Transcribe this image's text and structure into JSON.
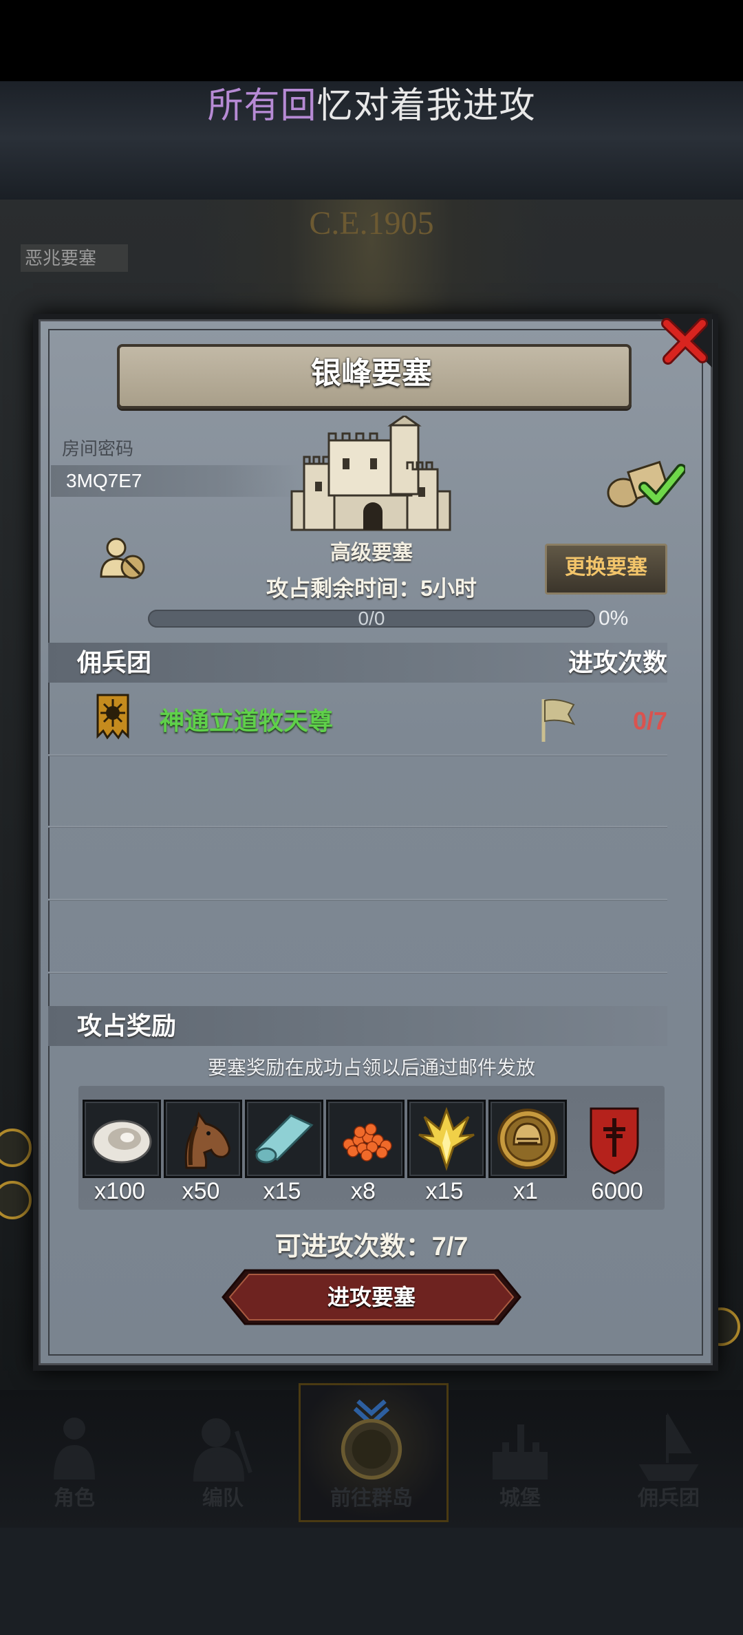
{
  "caption": {
    "highlight": "所有回",
    "rest": "忆对着我进攻"
  },
  "background": {
    "year": "C.E.1905",
    "fortress_tag": "恶兆要塞"
  },
  "dialog": {
    "title": "银峰要塞",
    "room_code_label": "房间密码",
    "room_code": "3MQ7E7",
    "fortress_level": "高级要塞",
    "time_remaining": "攻占剩余时间：5小时",
    "progress_text": "0/0",
    "progress_percent": "0%",
    "progress_fraction": 0,
    "change_button": "更换要塞",
    "mercenary_header": "佣兵团",
    "attacks_header": "进攻次数",
    "mercenaries": [
      {
        "name": "神通立道牧天尊",
        "attacks": "0/7"
      }
    ],
    "reward_header": "攻占奖励",
    "reward_note": "要塞奖励在成功占领以后通过邮件发放",
    "rewards": [
      {
        "icon": "oyster-icon",
        "qty": "x100"
      },
      {
        "icon": "horse-icon",
        "qty": "x50"
      },
      {
        "icon": "cloth-roll-icon",
        "qty": "x15"
      },
      {
        "icon": "caviar-icon",
        "qty": "x8"
      },
      {
        "icon": "golden-crest-icon",
        "qty": "x15"
      },
      {
        "icon": "knight-helmet-icon",
        "qty": "x1"
      },
      {
        "icon": "red-shield-icon",
        "qty": "6000"
      }
    ],
    "attack_count": "可进攻次数：7/7",
    "attack_button": "进攻要塞"
  },
  "nav": [
    {
      "label": "角色",
      "icon": "character-icon"
    },
    {
      "label": "编队",
      "icon": "formation-icon"
    },
    {
      "label": "前往群岛",
      "icon": "islands-icon"
    },
    {
      "label": "城堡",
      "icon": "castle-icon"
    },
    {
      "label": "佣兵团",
      "icon": "ship-icon"
    }
  ],
  "colors": {
    "accent_purple": "#b68ad4",
    "merc_green": "#5fd04a",
    "attack_red": "#d9534f",
    "button_gold": "#f2c46a"
  }
}
